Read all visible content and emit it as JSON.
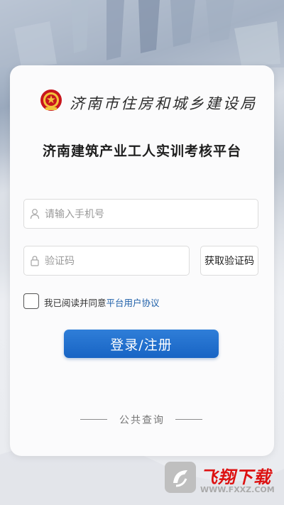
{
  "header": {
    "bureau_name": "济南市住房和城乡建设局",
    "platform_title": "济南建筑产业工人实训考核平台"
  },
  "form": {
    "phone_placeholder": "请输入手机号",
    "code_placeholder": "验证码",
    "get_code_label": "获取验证码",
    "agree_text": "我已阅读并同意",
    "agree_link": "平台用户协议",
    "login_label": "登录/注册"
  },
  "footer": {
    "public_query": "公共查询"
  },
  "watermark": {
    "brand": "飞翔下载",
    "url": "WWW.FXXZ.COM"
  },
  "colors": {
    "primary": "#1864c4",
    "link": "#1c5ea8",
    "brand_red": "#dd1111"
  }
}
